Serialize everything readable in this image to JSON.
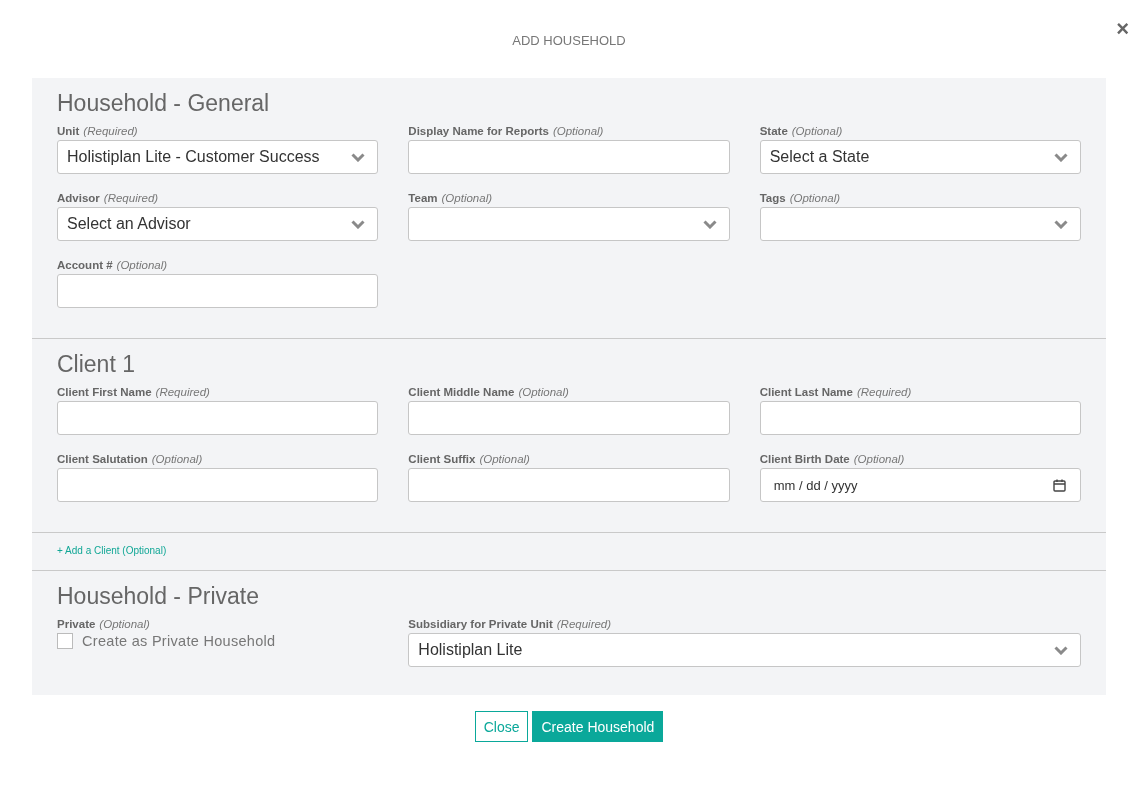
{
  "dialog": {
    "title": "ADD HOUSEHOLD",
    "close_icon": "×"
  },
  "sections": [
    {
      "kind": "fields",
      "heading": "Household - General",
      "fields": [
        {
          "kind": "select",
          "label": "Unit",
          "note": "(Required)",
          "value": "Holistiplan Lite - Customer Success"
        },
        {
          "kind": "text",
          "label": "Display Name for Reports",
          "note": "(Optional)"
        },
        {
          "kind": "select",
          "label": "State",
          "note": "(Optional)",
          "value": "Select a State"
        },
        {
          "kind": "select",
          "label": "Advisor",
          "note": "(Required)",
          "value": "Select an Advisor"
        },
        {
          "kind": "select",
          "label": "Team",
          "note": "(Optional)"
        },
        {
          "kind": "select",
          "label": "Tags",
          "note": "(Optional)"
        },
        {
          "kind": "text",
          "label": "Account #",
          "note": "(Optional)"
        }
      ]
    },
    {
      "kind": "fields",
      "heading": "Client 1",
      "fields": [
        {
          "kind": "text",
          "label": "Client First Name",
          "note": "(Required)"
        },
        {
          "kind": "text",
          "label": "Client Middle Name",
          "note": "(Optional)"
        },
        {
          "kind": "text",
          "label": "Client Last Name",
          "note": "(Required)"
        },
        {
          "kind": "text",
          "label": "Client Salutation",
          "note": "(Optional)"
        },
        {
          "kind": "text",
          "label": "Client Suffix",
          "note": "(Optional)"
        },
        {
          "kind": "date",
          "label": "Client Birth Date",
          "note": "(Optional)",
          "placeholder": "mm / dd / yyyy"
        }
      ]
    },
    {
      "kind": "link",
      "link": "+ Add a Client (Optional)"
    },
    {
      "kind": "fields",
      "heading": "Household - Private",
      "fields": [
        {
          "kind": "checkbox",
          "label": "Private",
          "note": "(Optional)",
          "option": "Create as Private Household",
          "checked": false
        },
        {
          "kind": "select",
          "label": "Subsidiary for Private Unit",
          "note": "(Required)",
          "value": "Holistiplan Lite"
        }
      ]
    }
  ],
  "buttons": [
    {
      "kind": "secondary",
      "label": "Close"
    },
    {
      "kind": "primary",
      "label": "Create Household"
    }
  ]
}
